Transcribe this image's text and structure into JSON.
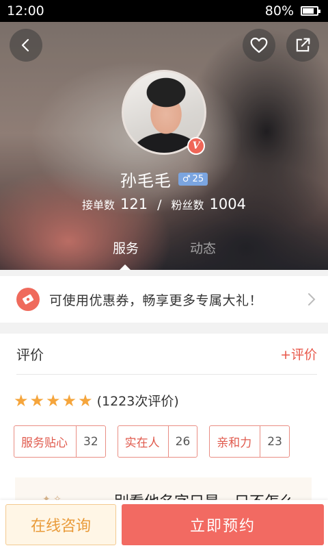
{
  "status_bar": {
    "time": "12:00",
    "battery": "80%",
    "battery_level": 0.8
  },
  "profile": {
    "name": "孙毛毛",
    "gender_symbol": "♂",
    "age": "25",
    "verified_badge": "V",
    "orders_label": "接单数",
    "orders_count": "121",
    "stat_separator": "/",
    "fans_label": "粉丝数",
    "fans_count": "1004"
  },
  "tabs": [
    {
      "label": "服务",
      "active": true
    },
    {
      "label": "动态",
      "active": false
    }
  ],
  "coupon": {
    "text": "可使用优惠券，畅享更多专属大礼！"
  },
  "reviews": {
    "title": "评价",
    "add_label": "+评价",
    "rating": 5,
    "count_text": "(1223次评价)",
    "tags": [
      {
        "label": "服务贴心",
        "count": "32"
      },
      {
        "label": "实在人",
        "count": "26"
      },
      {
        "label": "亲和力",
        "count": "23"
      }
    ],
    "peek_text": "别看他名字只是一只不怎么"
  },
  "bottom_bar": {
    "consult_label": "在线咨询",
    "book_label": "立即预约"
  },
  "colors": {
    "accent": "#f26a62",
    "star": "#f5a53c",
    "consult": "#e99b3a"
  }
}
